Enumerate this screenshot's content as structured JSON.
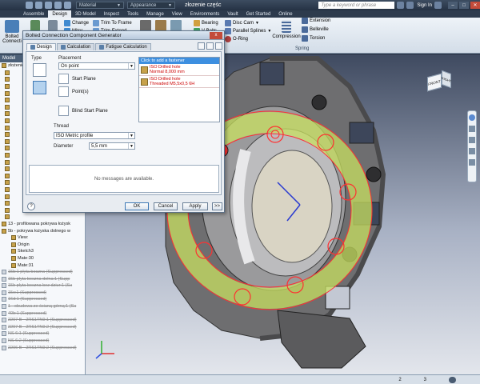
{
  "titlebar": {
    "material": "Material",
    "appearance": "Appearance",
    "doc_title": "złozenie częśc",
    "search_placeholder": "Type a keyword or phrase",
    "sign_in": "Sign In"
  },
  "menu": {
    "tabs": [
      "Assemble",
      "Design",
      "3D Model",
      "Inspect",
      "Tools",
      "Manage",
      "View",
      "Environments",
      "Vault",
      "Get Started",
      "Online"
    ]
  },
  "ribbon": {
    "bolted": "Bolted Connecti",
    "col1": [
      "Change",
      "Miter"
    ],
    "col2": [
      "Trim To Frame",
      "Trim-Extend"
    ],
    "bearing": "Bearing",
    "disc_cam": "Disc Cam",
    "v_belts": "V-Belts",
    "parallel_splines": "Parallel Splines",
    "o_ring": "O-Ring",
    "compression": "Compression",
    "extension": "Extension",
    "belleville": "Belleville",
    "torsion": "Torsion",
    "group_spring": "Spring"
  },
  "browser": {
    "title": "Model",
    "items": [
      {
        "label": "złożenie",
        "suppressed": false
      },
      {
        "label": "",
        "suppressed": false
      },
      {
        "label": "",
        "suppressed": false
      },
      {
        "label": "",
        "suppressed": false
      },
      {
        "label": "",
        "suppressed": false
      },
      {
        "label": "",
        "suppressed": false
      },
      {
        "label": "",
        "suppressed": false
      },
      {
        "label": "",
        "suppressed": false
      },
      {
        "label": "",
        "suppressed": false
      },
      {
        "label": "",
        "suppressed": false
      },
      {
        "label": "",
        "suppressed": false
      },
      {
        "label": "",
        "suppressed": false
      },
      {
        "label": "",
        "suppressed": false
      },
      {
        "label": "",
        "suppressed": false
      },
      {
        "label": "",
        "suppressed": false
      },
      {
        "label": "",
        "suppressed": false
      },
      {
        "label": "",
        "suppressed": false
      },
      {
        "label": "",
        "suppressed": false
      },
      {
        "label": "",
        "suppressed": false
      },
      {
        "label": "",
        "suppressed": false
      },
      {
        "label": "",
        "suppressed": false
      },
      {
        "label": "",
        "suppressed": false
      },
      {
        "label": "",
        "suppressed": false
      },
      {
        "label": "13 - profilowana pokrywa łożysk",
        "suppressed": false
      },
      {
        "label": "5b - pokrywa łożyska dolnego w",
        "suppressed": false
      },
      {
        "label": "View:",
        "suppressed": false
      },
      {
        "label": "Origin",
        "suppressed": false
      },
      {
        "label": "Sketch3",
        "suppressed": false
      },
      {
        "label": "Mate:30",
        "suppressed": false
      },
      {
        "label": "Mate:31",
        "suppressed": false
      },
      {
        "label": "15b:1 płyta boczna (Suppressed)",
        "suppressed": true
      },
      {
        "label": "15b płyta boczna dolna:1 (Supp",
        "suppressed": true
      },
      {
        "label": "15b płyta boczna bez dziur:1 (Su",
        "suppressed": true
      },
      {
        "label": "15c:1 (Suppressed)",
        "suppressed": true
      },
      {
        "label": "16d:1 (Suppressed)",
        "suppressed": true
      },
      {
        "label": "1 - obudowa ze ścianą górną:1 (Su",
        "suppressed": true
      },
      {
        "label": "40b:1 (Suppressed)",
        "suppressed": true
      },
      {
        "label": "2207 B - 2RS1TN9:1 (Suppressed)",
        "suppressed": true
      },
      {
        "label": "2207 B - 2RS1TN9:2 (Suppressed)",
        "suppressed": true
      },
      {
        "label": "NS 6:1 (Suppressed)",
        "suppressed": true
      },
      {
        "label": "NS 6:2 (Suppressed)",
        "suppressed": true
      },
      {
        "label": "2206 B - 2RS1TN9:2 (Suppressed)",
        "suppressed": true
      }
    ]
  },
  "dialog": {
    "title": "Bolted Connection Component Generator",
    "close": "x",
    "tabs": [
      "Design",
      "Calculation",
      "Fatigue Calculation"
    ],
    "type_label": "Type",
    "placement_label": "Placement",
    "placement_value": "On point",
    "start_plane": "Start Plane",
    "points": "Point(s)",
    "blind_start_plane": "Blind Start Plane",
    "thread_label": "Thread",
    "thread_value": "ISO Metric profile",
    "diameter_label": "Diameter",
    "diameter_value": "5,5 mm",
    "fastener_header": "Click to add a fastener",
    "fasteners": [
      {
        "line1": "ISO Drilled hole",
        "line2": "Normal 8,000 mm"
      },
      {
        "line1": "ISO Drilled hole",
        "line2": "Threaded M5,5x0,5 6H"
      }
    ],
    "messages": "No messages are available.",
    "ok": "OK",
    "cancel": "Cancel",
    "apply": "Apply",
    "more": ">>",
    "help": "?"
  },
  "status": {
    "page": "2",
    "count": "3"
  },
  "viewcube": {
    "front": "FRONT",
    "right": "RIGHT"
  },
  "colors": {
    "accent": "#3d8fe0",
    "error_text": "#c00000",
    "bolt_highlight": "#ff3030",
    "preview_fill": "#c8e060"
  }
}
